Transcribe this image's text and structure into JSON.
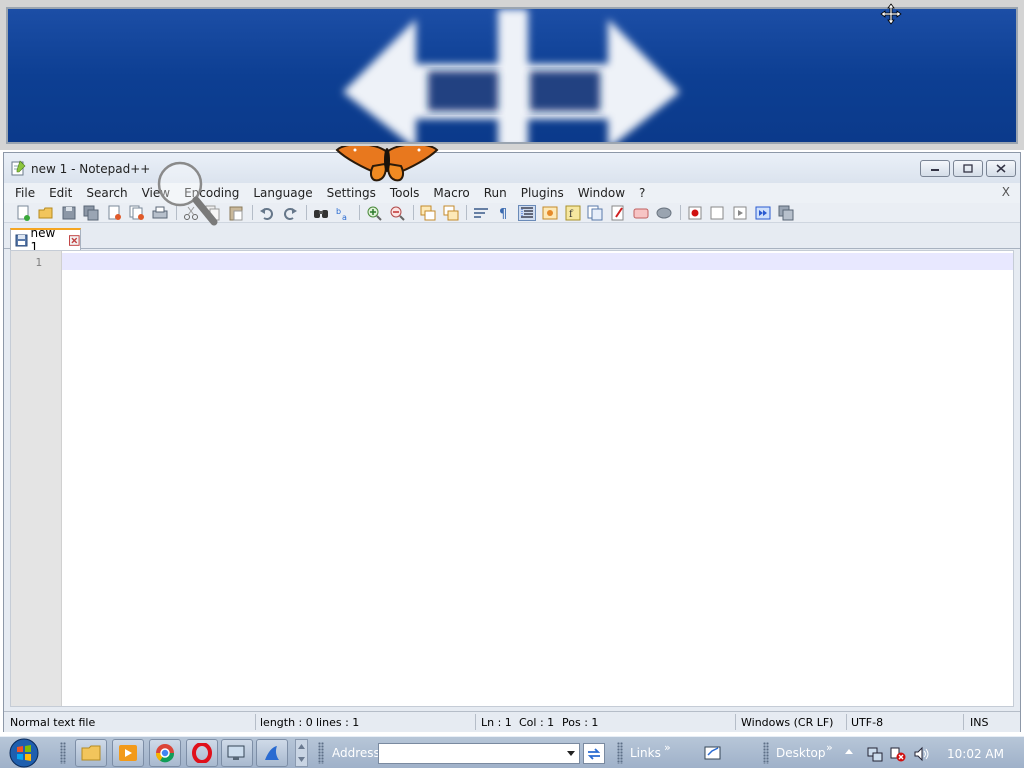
{
  "window": {
    "title": "new 1 - Notepad++"
  },
  "menu": {
    "items": [
      "File",
      "Edit",
      "Search",
      "View",
      "Encoding",
      "Language",
      "Settings",
      "Tools",
      "Macro",
      "Run",
      "Plugins",
      "Window",
      "?"
    ],
    "close_doc": "X"
  },
  "toolbar": {
    "icons": [
      "new-file-icon",
      "open-file-icon",
      "save-icon",
      "save-all-icon",
      "close-icon",
      "close-all-icon",
      "print-icon",
      "cut-icon",
      "copy-icon",
      "paste-icon",
      "undo-icon",
      "redo-icon",
      "find-icon",
      "replace-icon",
      "zoom-in-icon",
      "zoom-out-icon",
      "sync-vertical-icon",
      "sync-horizontal-icon",
      "word-wrap-icon",
      "show-all-chars-icon",
      "indent-guide-icon",
      "doc-map-icon",
      "function-list-icon",
      "folder-as-workspace-icon",
      "monitoring-icon",
      "record-macro-icon",
      "stop-macro-icon",
      "play-macro-icon",
      "run-macro-multiple-icon",
      "save-macro-icon"
    ]
  },
  "tab": {
    "label": "new 1"
  },
  "editor": {
    "line_number": "1"
  },
  "status": {
    "file_type": "Normal text file",
    "length": "length : 0",
    "lines": "lines : 1",
    "ln": "Ln : 1",
    "col": "Col : 1",
    "pos": "Pos : 1",
    "eol": "Windows (CR LF)",
    "encoding": "UTF-8",
    "mode": "INS"
  },
  "taskbar": {
    "address_label": "Address",
    "address_value": "",
    "links_label": "Links",
    "desktop_label": "Desktop",
    "chevron": "»",
    "time": "10:02 AM"
  },
  "colors": {
    "banner_blue": "#0d3f93",
    "tab_accent": "#f5a623",
    "current_line": "#e8e8ff"
  }
}
